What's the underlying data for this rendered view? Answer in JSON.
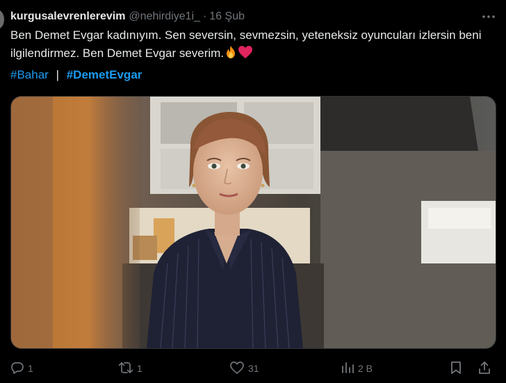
{
  "tweet": {
    "display_name": "kurgusalevrenlerevim",
    "handle": "@nehirdiye1i_",
    "separator": "·",
    "time": "16 Şub",
    "text": "Ben Demet Evgar kadınıyım. Sen seversin, sevmezsin, yeteneksiz oyuncuları izlersin beni ilgilendirmez. Ben Demet Evgar severim.",
    "hashtags": [
      "#Bahar",
      "#DemetEvgar"
    ],
    "hashtag_separator": "|"
  },
  "actions": {
    "replies": "1",
    "retweets": "1",
    "likes": "31",
    "views": "2 B"
  },
  "icons": {
    "more": "more-dots-icon",
    "reply": "reply-icon",
    "retweet": "retweet-icon",
    "like": "heart-icon",
    "views": "views-icon",
    "bookmark": "bookmark-icon",
    "share": "share-icon",
    "emoji_1": "fire-icon",
    "emoji_2": "red-heart-icon"
  },
  "colors": {
    "background": "#000000",
    "text": "#e7e9ea",
    "muted": "#71767b",
    "link": "#1d9bf0",
    "heart": "#e0245e"
  }
}
